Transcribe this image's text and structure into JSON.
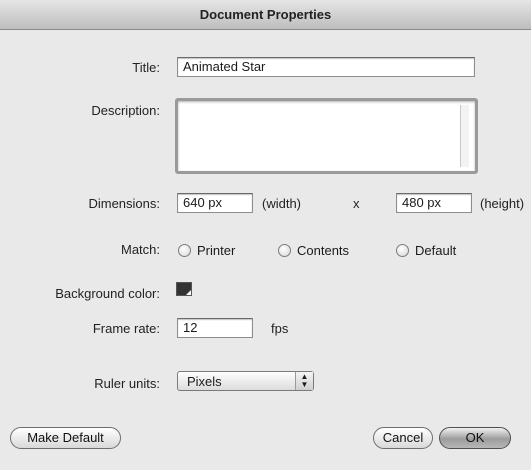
{
  "window": {
    "title": "Document Properties"
  },
  "form": {
    "title_label": "Title:",
    "title_value": "Animated Star",
    "description_label": "Description:",
    "description_value": "",
    "dimensions_label": "Dimensions:",
    "width_value": "640 px",
    "width_unit": "(width)",
    "by": "x",
    "height_value": "480 px",
    "height_unit": "(height)",
    "match_label": "Match:",
    "match_options": [
      "Printer",
      "Contents",
      "Default"
    ],
    "background_label": "Background color:",
    "background_color": "#333333",
    "frame_rate_label": "Frame rate:",
    "frame_rate_value": "12",
    "frame_rate_unit": "fps",
    "ruler_label": "Ruler units:",
    "ruler_value": "Pixels"
  },
  "buttons": {
    "make_default": "Make Default",
    "cancel": "Cancel",
    "ok": "OK"
  },
  "icons": {
    "popup_arrows": "up-down-arrows-icon",
    "color_swatch": "color-swatch-icon"
  }
}
